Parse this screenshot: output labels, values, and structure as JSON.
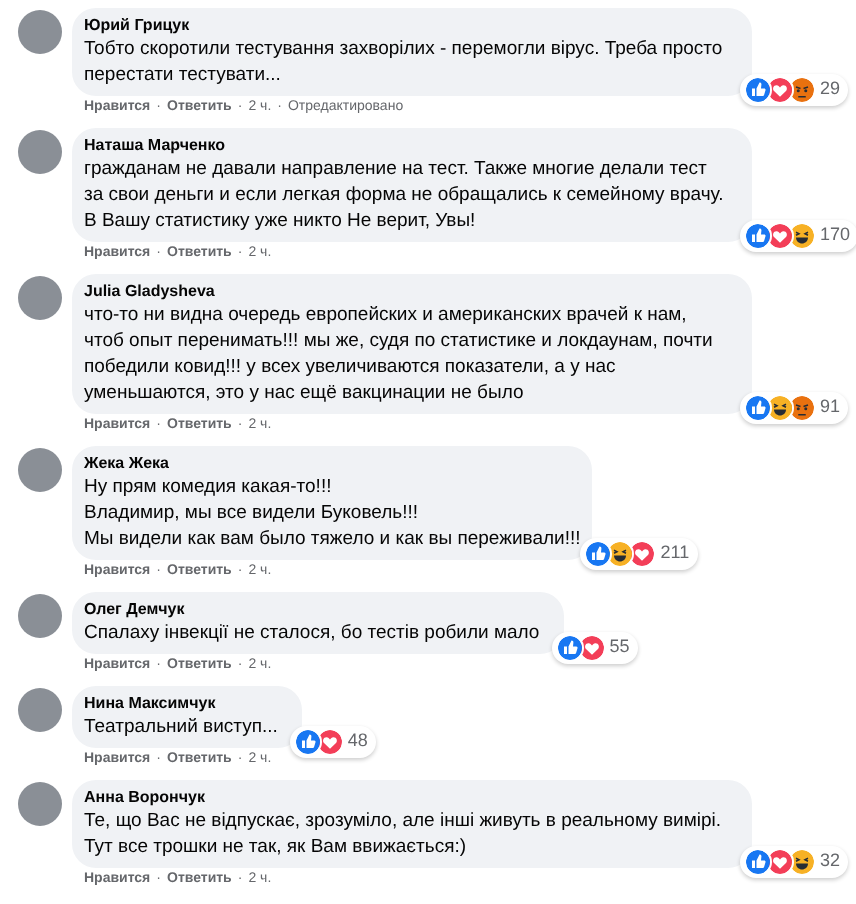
{
  "separator": "·",
  "comments": [
    {
      "author": "Юрий Грицук",
      "text": "Тобто скоротили тестування захворілих - перемогли вірус. Треба просто перестати тестувати...",
      "reactions": [
        {
          "kind": "like"
        },
        {
          "kind": "love"
        },
        {
          "kind": "angry"
        }
      ],
      "count": "29",
      "actions": [
        "Нравится",
        "Ответить",
        "2 ч.",
        "Отредактировано"
      ]
    },
    {
      "author": "Наташа Марченко",
      "text": "гражданам не давали направление на тест. Также многие делали тест за свои деньги и если легкая форма не обращались к семейному врачу. В Вашу статистику уже никто Не верит, Увы!",
      "reactions": [
        {
          "kind": "like"
        },
        {
          "kind": "love"
        },
        {
          "kind": "haha"
        }
      ],
      "count": "170",
      "actions": [
        "Нравится",
        "Ответить",
        "2 ч."
      ]
    },
    {
      "author": "Julia Gladysheva",
      "text": "что-то ни видна очередь европейских и американских врачей к нам, чтоб опыт перенимать!!! мы же, судя по статистике и локдаунам, почти победили ковид!!! у всех увеличиваются показатели, а у нас уменьшаются, это у нас ещё вакцинации не было",
      "reactions": [
        {
          "kind": "like"
        },
        {
          "kind": "haha"
        },
        {
          "kind": "angry"
        }
      ],
      "count": "91",
      "actions": [
        "Нравится",
        "Ответить",
        "2 ч."
      ]
    },
    {
      "author": "Жека Жека",
      "lines": [
        "Ну прям комедия какая-то!!!",
        "Владимир, мы все видели Буковель!!!",
        "Мы видели как вам было тяжело и как вы переживали!!!"
      ],
      "reactions": [
        {
          "kind": "like"
        },
        {
          "kind": "haha"
        },
        {
          "kind": "love"
        }
      ],
      "count": "211",
      "actions": [
        "Нравится",
        "Ответить",
        "2 ч."
      ]
    },
    {
      "author": "Олег Демчук",
      "text": "Спалаху інвекції не сталося, бо тестів робили мало",
      "reactions": [
        {
          "kind": "like"
        },
        {
          "kind": "love"
        }
      ],
      "count": "55",
      "actions": [
        "Нравится",
        "Ответить",
        "2 ч."
      ]
    },
    {
      "author": "Нина Максимчук",
      "text": "Театральний виступ...",
      "reactions": [
        {
          "kind": "like"
        },
        {
          "kind": "love"
        }
      ],
      "count": "48",
      "actions": [
        "Нравится",
        "Ответить",
        "2 ч."
      ]
    },
    {
      "author": "Анна Ворончук",
      "text": "Те, що Вас не відпускає, зрозуміло, але інші живуть в реальному вимірі. Тут все трошки не так, як Вам ввижається:)",
      "reactions": [
        {
          "kind": "like"
        },
        {
          "kind": "love"
        },
        {
          "kind": "haha"
        }
      ],
      "count": "32",
      "actions": [
        "Нравится",
        "Ответить",
        "2 ч."
      ]
    }
  ]
}
